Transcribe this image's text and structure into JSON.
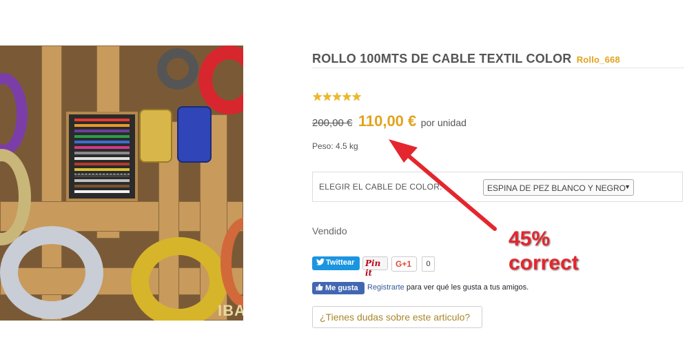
{
  "product": {
    "image_alt": "Rollos de cable textil de colores",
    "watermark": "IBA",
    "title": "ROLLO 100MTS DE CABLE TEXTIL COLOR",
    "reference": "Rollo_668",
    "rating_stars": 5,
    "stars_text": "★★★★★",
    "old_price": "200,00 €",
    "price": "110,00 €",
    "unit": "por unidad",
    "weight": "Peso: 4.5 kg",
    "status": "Vendido"
  },
  "options": {
    "label": "ELEGIR EL CABLE DE COLOR:",
    "selected": "ESPINA DE PEZ BLANCO Y NEGRO",
    "arrow": "▼"
  },
  "social": {
    "twitter_label": "Twittear",
    "pinterest_label": "Pin it",
    "gplus_label": "G+1",
    "gplus_count": "0",
    "facebook_label": "Me gusta",
    "facebook_link": "Registrarte",
    "facebook_text": "para ver qué les gusta a tus amigos."
  },
  "question_button": "¿Tienes dudas sobre este articulo?",
  "annotation": {
    "line1": "45%",
    "line2": "correct",
    "color": "#e4262e"
  },
  "colors": {
    "accent": "#e2a31c",
    "twitter": "#1b95e0",
    "facebook": "#4267b2",
    "pinterest": "#bd081c"
  }
}
